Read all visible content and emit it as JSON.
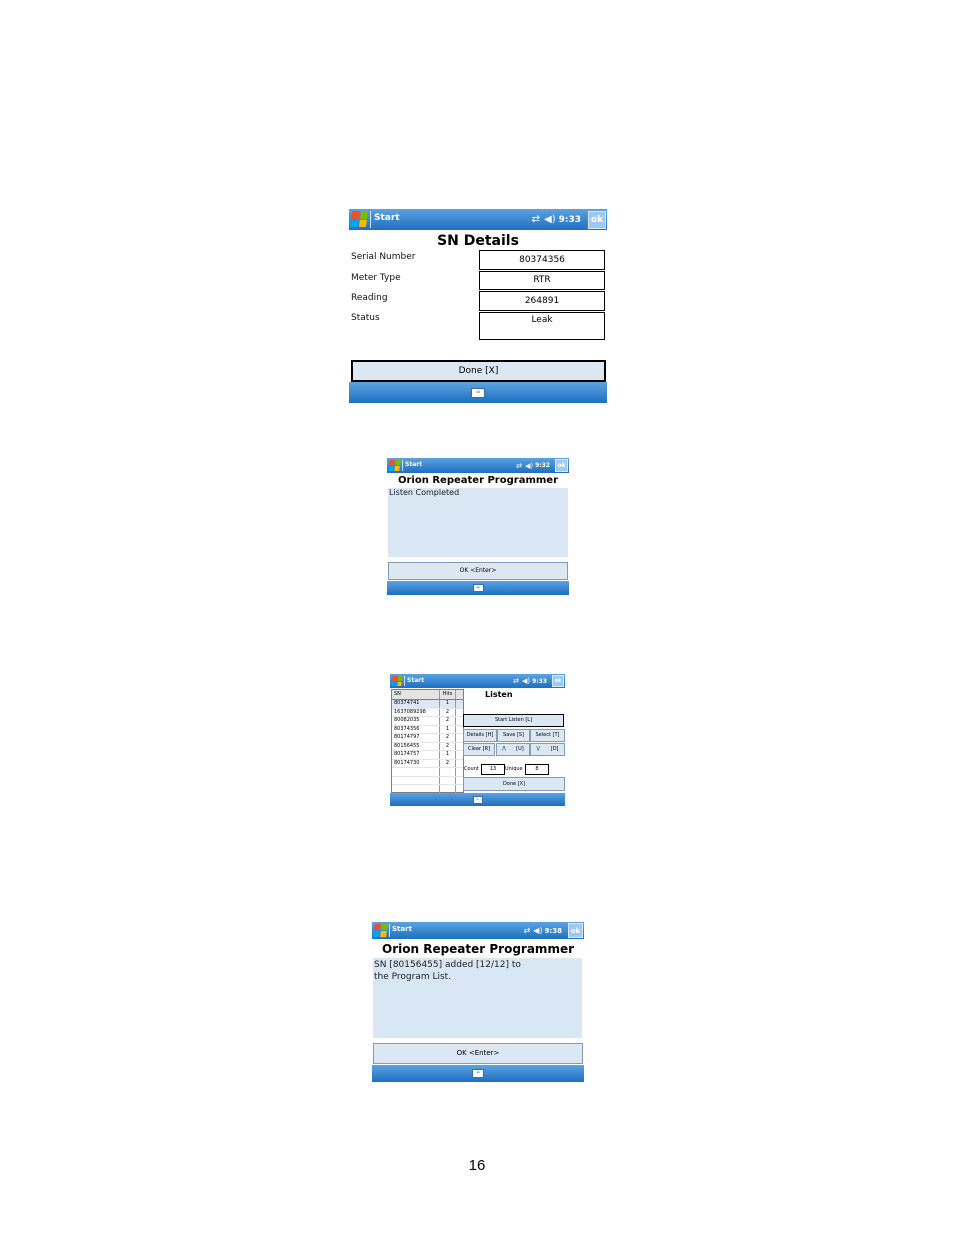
{
  "screens": {
    "sn_details": {
      "start_label": "Start",
      "time": "9:33",
      "ok_label": "ok",
      "title": "SN Details",
      "labels": [
        "Serial Number",
        "Meter Type",
        "Reading",
        "Status"
      ],
      "values": [
        "80374356",
        "RTR",
        "264891",
        "Leak"
      ],
      "done_label": "Done [X]"
    },
    "listen_completed": {
      "start_label": "Start",
      "time": "9:32",
      "ok_label": "ok",
      "title": "Orion Repeater Programmer",
      "message": "Listen Completed",
      "ok_enter_label": "OK <Enter>"
    },
    "listen": {
      "start_label": "Start",
      "time": "9:33",
      "ok_label": "ok",
      "title": "Listen",
      "columns": [
        "SN",
        "Hits"
      ],
      "rows": [
        {
          "sn": "80374741",
          "hits": "1"
        },
        {
          "sn": "1637089298",
          "hits": "2"
        },
        {
          "sn": "80082035",
          "hits": "2"
        },
        {
          "sn": "80374356",
          "hits": "1"
        },
        {
          "sn": "80174797",
          "hits": "2"
        },
        {
          "sn": "80156455",
          "hits": "2"
        },
        {
          "sn": "80174757",
          "hits": "1"
        },
        {
          "sn": "80174730",
          "hits": "2"
        }
      ],
      "start_listen_label": "Start Listen [L]",
      "details_label": "Details [H]",
      "save_label": "Save [S]",
      "select_label": "Select [T]",
      "clear_label": "Clear [R]",
      "up_label": "/\\",
      "u_label": "[U]",
      "down_label": "\\/",
      "d_label": "[D]",
      "count_label": "Count",
      "count_value": "13",
      "unique_label": "Unique",
      "unique_value": "8",
      "done_label": "Done [X]"
    },
    "sn_added": {
      "start_label": "Start",
      "time": "9:38",
      "ok_label": "ok",
      "title": "Orion Repeater Programmer",
      "message": "SN [80156455] added [12/12] to the Program List.",
      "ok_enter_label": "OK <Enter>"
    }
  },
  "page_number": "16"
}
